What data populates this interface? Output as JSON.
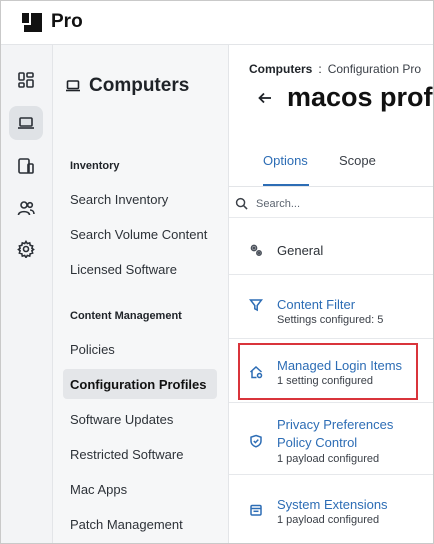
{
  "app": {
    "name": "Pro"
  },
  "rail": {
    "items": [
      {
        "name": "dashboard",
        "icon": "dashboard-icon"
      },
      {
        "name": "computers",
        "icon": "laptop-icon",
        "active": true
      },
      {
        "name": "devices",
        "icon": "devices-icon"
      },
      {
        "name": "users",
        "icon": "users-icon"
      },
      {
        "name": "settings",
        "icon": "gear-icon"
      }
    ]
  },
  "sidebar": {
    "title": "Computers",
    "sections": [
      {
        "label": "Inventory",
        "items": [
          "Search Inventory",
          "Search Volume Content",
          "Licensed Software"
        ]
      },
      {
        "label": "Content Management",
        "items": [
          "Policies",
          "Configuration Profiles",
          "Software Updates",
          "Restricted Software",
          "Mac Apps",
          "Patch Management"
        ]
      }
    ],
    "selected": "Configuration Profiles"
  },
  "main": {
    "breadcrumb": {
      "root": "Computers",
      "separator": ":",
      "current": "Configuration Pro"
    },
    "title": "macos prof",
    "tabs": [
      {
        "label": "Options",
        "active": true
      },
      {
        "label": "Scope",
        "active": false
      }
    ],
    "search": {
      "placeholder": "Search...",
      "value": ""
    },
    "payloads": [
      {
        "name": "General",
        "status": "",
        "icon": "gears-icon"
      },
      {
        "name": "Content Filter",
        "status": "Settings configured: 5",
        "icon": "filter-icon"
      },
      {
        "name": "Managed Login Items",
        "status": "1 setting configured",
        "icon": "home-gear-icon",
        "highlighted": true
      },
      {
        "name_line1": "Privacy Preferences",
        "name_line2": "Policy Control",
        "status": "1 payload configured",
        "icon": "shield-check-icon"
      },
      {
        "name": "System Extensions",
        "status": "1 payload configured",
        "icon": "extension-icon"
      }
    ]
  },
  "colors": {
    "accent": "#2d6db5",
    "highlight": "#d9343b"
  }
}
